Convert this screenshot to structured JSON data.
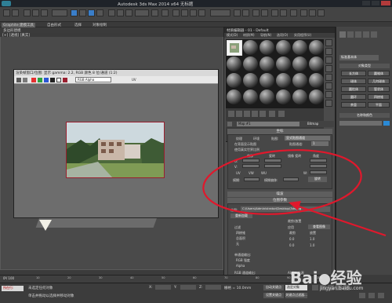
{
  "app": {
    "title": "Autodesk 3ds Max 2014 x64   无标题"
  },
  "ribbon": {
    "tabs": [
      "Graphite 建模工具",
      "自由形式",
      "选择",
      "对象绘制"
    ],
    "active_index": 0,
    "sub_label": "多边形建模"
  },
  "viewport": {
    "label": "[+] [透视] [真实]"
  },
  "image_viewer": {
    "title": "渲染帧窗口/位图: 显示 gamma: 2.2, RGB 颜色 8 位/通道 (1:2)",
    "tool_label": "RGB Alpha",
    "zoom_label": "UV"
  },
  "material_editor": {
    "title": "材质编辑器 - 01 - Default",
    "menu": [
      "模式(D)",
      "材质(M)",
      "导航(N)",
      "选项(O)",
      "实用程序(U)"
    ],
    "name_field": "Map #1",
    "type_button": "Bitmap",
    "rollout_coords": "坐标",
    "texture_label": "纹理",
    "env_label": "环境",
    "mapping_label": "贴图:",
    "mapping_value": "显式贴图通道",
    "channel_label": "贴图通道:",
    "channel_value": "1",
    "show_map_back": "在背面显示贴图",
    "real_world": "使用真实世界比例",
    "offset_label": "偏移",
    "tiling_label": "瓷砖",
    "mirror_label": "镜像 瓷砖",
    "angle_label": "角度",
    "u_label": "U:",
    "v_label": "V:",
    "w_label": "W:",
    "uv": "UV",
    "vw": "VW",
    "wu": "WU",
    "blur_label": "模糊:",
    "blur_offset_label": "模糊偏移:",
    "rotate_button": "旋转",
    "noise_label": "噪波",
    "rollout_bitmap": "位图参数",
    "bitmap_path_label": "位图:",
    "bitmap_path": "C:\\Users\\Administrator\\Desktop\\3ds.jpg",
    "reload_button": "重新加载",
    "filter_label": "过滤",
    "filter_options": [
      "四棱锥",
      "总面积",
      "无"
    ],
    "crop_label": "裁剪/放置",
    "apply_label": "应用",
    "view_image_button": "查看图像",
    "crop_option": "裁剪",
    "place_option": "放置",
    "u_val": "0.0",
    "w_val": "1.0",
    "v_val": "0.0",
    "h_val": "1.0",
    "mono_label": "单通道输出:",
    "mono_options": [
      "RGB 强度",
      "Alpha"
    ],
    "rgb_out_label": "RGB 通道输出:",
    "alpha_source_label": "Alpha 来源",
    "num_default": "0.0",
    "num_one": "1.0"
  },
  "command_panel": {
    "dropdown": "标准基本体",
    "object_type": "对象类型",
    "buttons": [
      "长方体",
      "圆锥体",
      "球体",
      "几何球体",
      "圆柱体",
      "管状体",
      "圆环",
      "四棱锥",
      "茶壶",
      "平面"
    ],
    "name_color": "名称和颜色"
  },
  "timeline": {
    "frame": "0 / 100",
    "ticks": [
      "0",
      "10",
      "20",
      "30",
      "40",
      "50",
      "60",
      "70",
      "80",
      "90",
      "100"
    ]
  },
  "status": {
    "left_badge": "所在行:",
    "line1": "未选定任何对象",
    "line2": "单击并拖动以选择并移动对象",
    "x_label": "X:",
    "y_label": "Y:",
    "z_label": "Z:",
    "grid": "栅格 = 10.0mm",
    "auto_key": "自动关键点",
    "set_key": "设置关键点",
    "selected": "选定对象",
    "filter": "关键点过滤器..."
  },
  "watermark": {
    "brand": "Bai",
    "brand2": "经验",
    "site": "jingyan.baidu.com"
  },
  "colors": {
    "red_marker": "#e0182c",
    "accent_blue": "#3a7ec9"
  }
}
